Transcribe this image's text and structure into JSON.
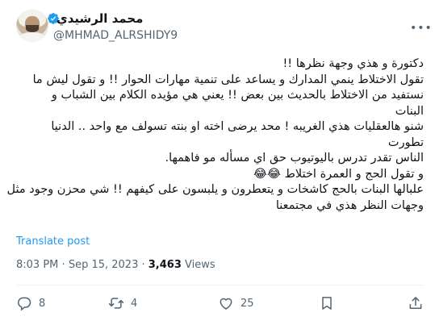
{
  "author": {
    "name": "محمد الرشيدي",
    "handle": "@MHMAD_ALRSHIDY9",
    "verified": true
  },
  "tweet": {
    "lines": [
      "دكتورة و هذي وجهة نظرها !!",
      "تقول الاختلاط ينمي المدارك و يساعد على تنمية مهارات الحوار !! و تقول ليش ما",
      "نستفيد من الاختلاط بالحديث بين بعض !! يعني هي مؤيده الكلام بين الشباب و",
      "البنات",
      "شنو هالعقليات هذي الغريبه ! محد يرضى اخته او بنته تسولف مع واحد .. الدنيا",
      "تطورت",
      "الناس تقدر تدرس باليوتيوب حق اي مسأله مو فاهمها.",
      "و تقول الحج و العمرة اختلاط 😂😂",
      "علبالها البنات بالحج كاشخات و يتعطرون و يلبسون على كيفهم !! شي محزن وجود مثل",
      "وجهات النظر هذي في مجتمعنا"
    ]
  },
  "translate_label": "Translate post",
  "meta": {
    "time": "8:03 PM",
    "separator": "·",
    "date": "Sep 15, 2023",
    "views_count": "3,463",
    "views_label": "Views"
  },
  "actions": {
    "replies": "8",
    "reposts": "4",
    "likes": "25"
  },
  "icons": [
    "more-icon",
    "verified-icon",
    "reply-icon",
    "repost-icon",
    "like-icon",
    "bookmark-icon",
    "share-icon"
  ],
  "colors": {
    "text": "#0f1419",
    "secondary": "#536471",
    "accent": "#1d9bf0"
  }
}
